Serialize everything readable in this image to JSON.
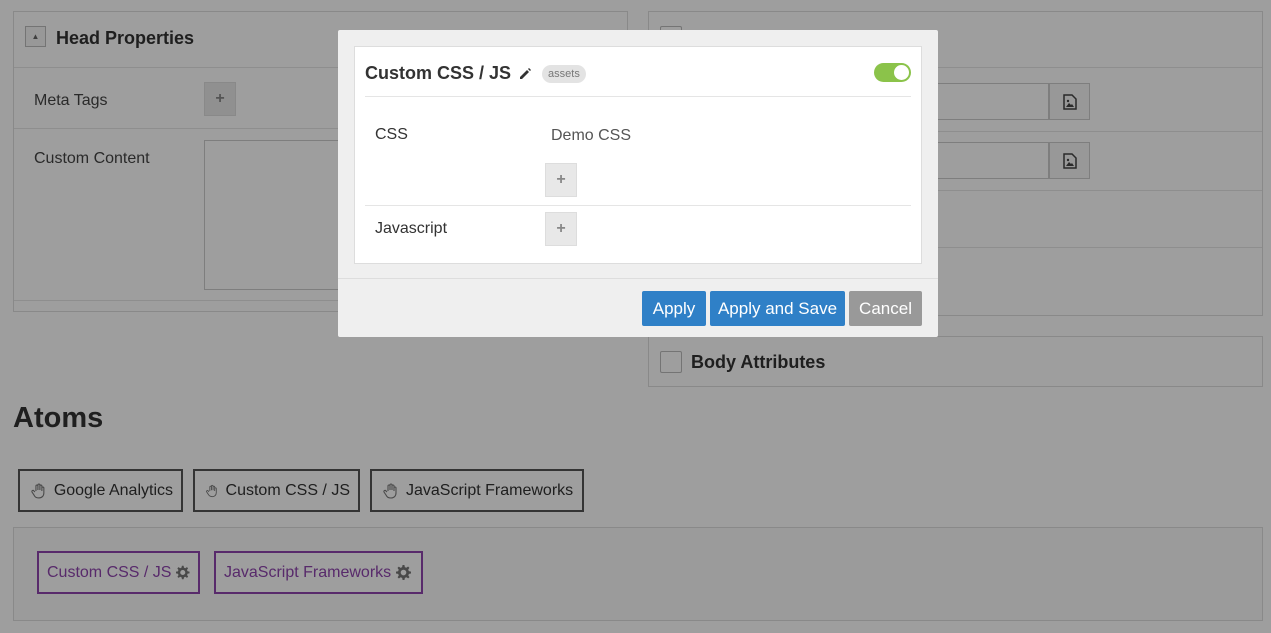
{
  "head_panel": {
    "title": "Head Properties",
    "meta_tags_label": "Meta Tags",
    "custom_content_label": "Custom Content"
  },
  "body_panel": {
    "body_attributes_label": "Body Attributes"
  },
  "atoms": {
    "title": "Atoms",
    "items": [
      "Google Analytics",
      "Custom CSS / JS",
      "JavaScript Frameworks"
    ]
  },
  "dropped_atoms": [
    "Custom CSS / JS",
    "JavaScript Frameworks"
  ],
  "modal": {
    "title": "Custom CSS / JS",
    "badge": "assets",
    "enabled": true,
    "css_label": "CSS",
    "css_items": [
      "Demo CSS"
    ],
    "javascript_label": "Javascript",
    "buttons": {
      "apply": "Apply",
      "apply_save": "Apply and Save",
      "cancel": "Cancel"
    }
  },
  "colors": {
    "primary_button": "#2f80c7",
    "cancel_button": "#999999",
    "toggle_on": "#8bc34a",
    "dropped_atom": "#8e44ad"
  },
  "icons": [
    "collapse-icon",
    "plus-icon",
    "file-image-icon",
    "hand-icon",
    "gear-icon",
    "pencil-icon"
  ]
}
